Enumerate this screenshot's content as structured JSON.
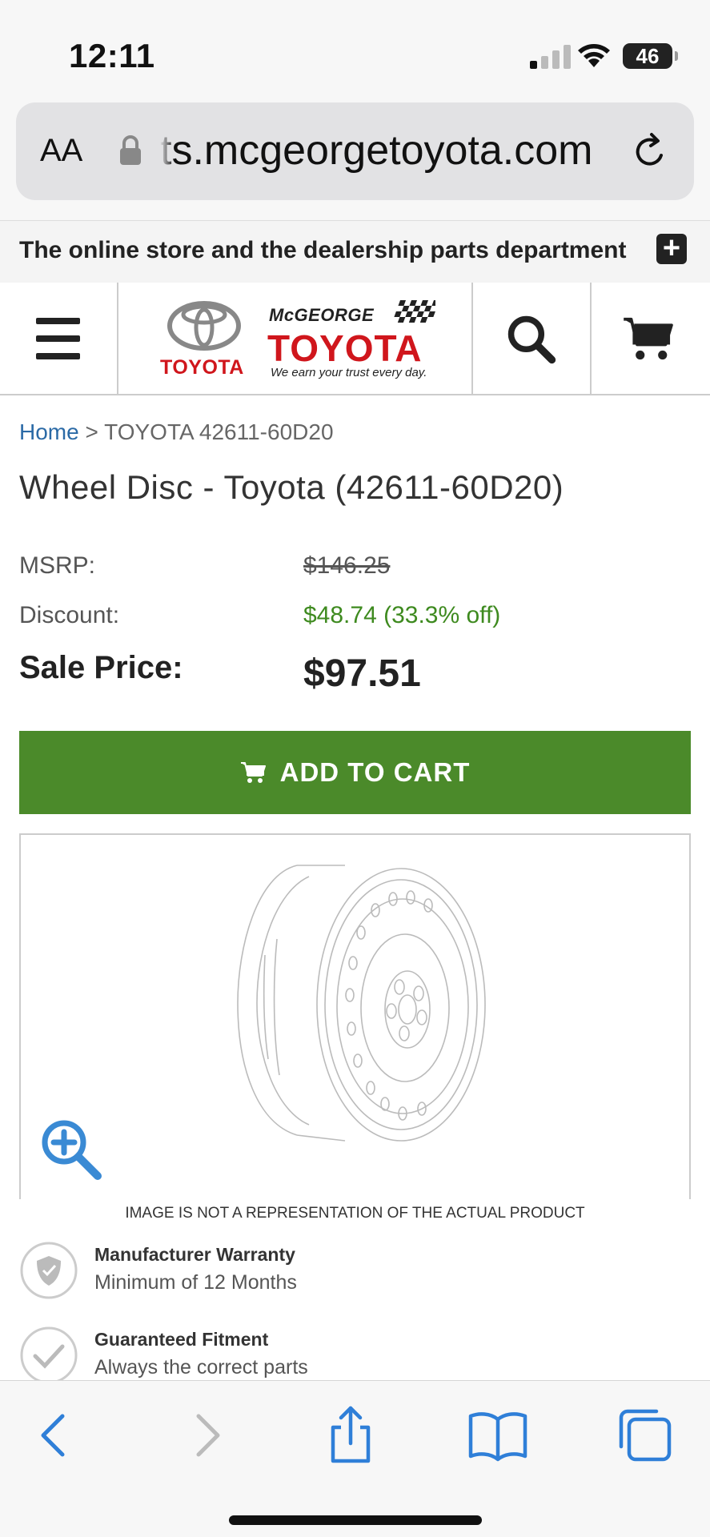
{
  "status_bar": {
    "time": "12:11",
    "battery": "46"
  },
  "browser": {
    "text_size_label": "AA",
    "url": "ts.mcgeorgetoyota.com"
  },
  "announcement": {
    "text": "The online store and the dealership parts department"
  },
  "header": {
    "brand_word": "TOYOTA",
    "dealer_top": "McGEORGE",
    "dealer_big": "TOYOTA",
    "dealer_tagline": "We earn your trust every day."
  },
  "breadcrumb": {
    "home": "Home",
    "separator": ">",
    "current": "TOYOTA 42611-60D20"
  },
  "product": {
    "title": "Wheel Disc - Toyota (42611-60D20)",
    "msrp_label": "MSRP:",
    "msrp_value": "$146.25",
    "discount_label": "Discount:",
    "discount_value": "$48.74 (33.3% off)",
    "sale_label": "Sale Price:",
    "sale_value": "$97.51",
    "add_to_cart": "ADD TO CART",
    "image_disclaimer": "IMAGE IS NOT A REPRESENTATION OF THE ACTUAL PRODUCT"
  },
  "features": [
    {
      "title": "Manufacturer Warranty",
      "subtitle": "Minimum of 12 Months",
      "icon": "shield-icon"
    },
    {
      "title": "Guaranteed Fitment",
      "subtitle": "Always the correct parts",
      "icon": "checkmark-icon"
    }
  ],
  "colors": {
    "add_to_cart_bg": "#4b8a2a",
    "discount_text": "#3e8a1f",
    "link_blue": "#2b6aa6",
    "brand_red": "#d0161c",
    "ios_blue": "#2f7fd8"
  }
}
